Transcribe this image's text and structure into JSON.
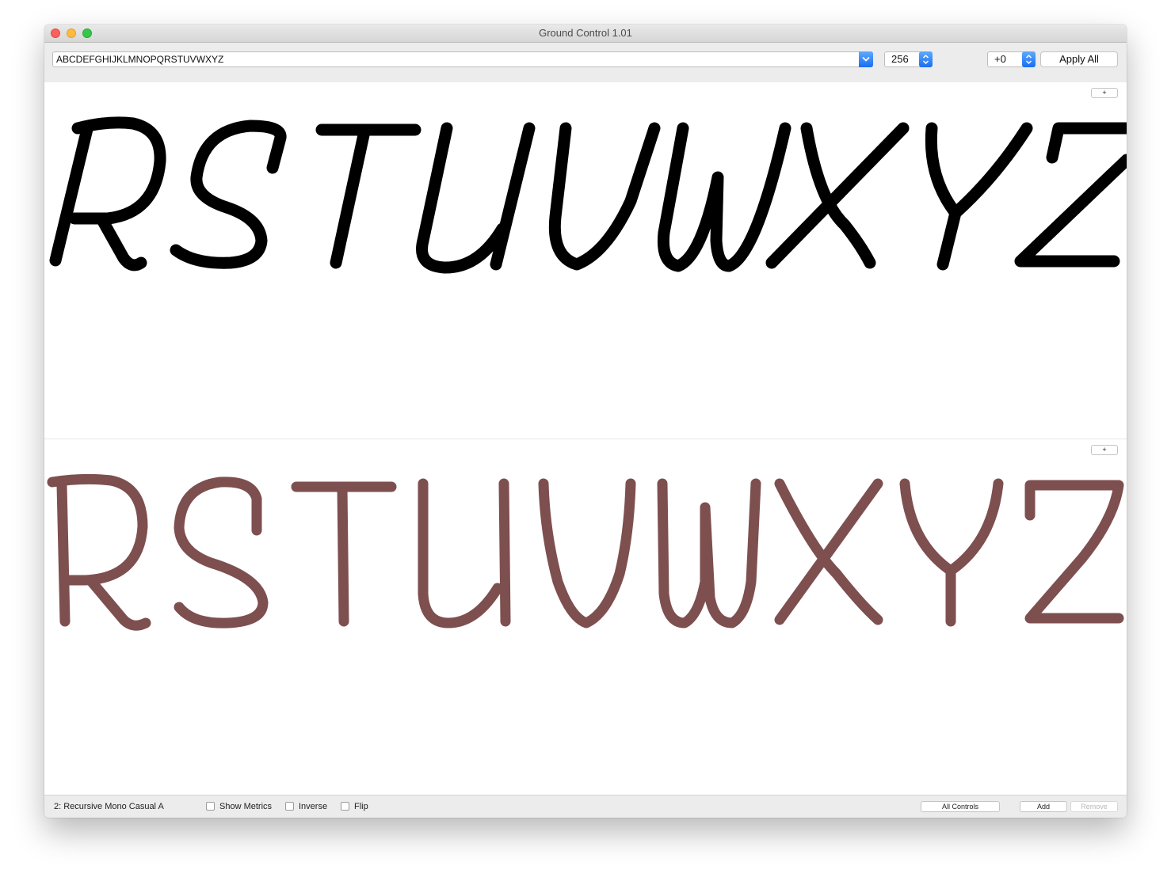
{
  "window": {
    "title": "Ground Control 1.01"
  },
  "toolbar": {
    "text_value": "ABCDEFGHIJKLMNOPQRSTUVWXYZ",
    "size_value": "256",
    "offset_value": "+0",
    "apply_all_label": "Apply All"
  },
  "panels": [
    {
      "plus_label": "+",
      "glyph_color": "#000000",
      "style": "italic-casual"
    },
    {
      "plus_label": "+",
      "glyph_color": "#7e4f4f",
      "style": "upright-casual"
    }
  ],
  "statusbar": {
    "font_label": "2: Recursive Mono Casual A",
    "show_metrics_label": "Show Metrics",
    "show_metrics_checked": false,
    "inverse_label": "Inverse",
    "inverse_checked": false,
    "flip_label": "Flip",
    "flip_checked": false,
    "all_controls_label": "All Controls",
    "add_label": "Add",
    "remove_label": "Remove",
    "remove_enabled": false
  }
}
